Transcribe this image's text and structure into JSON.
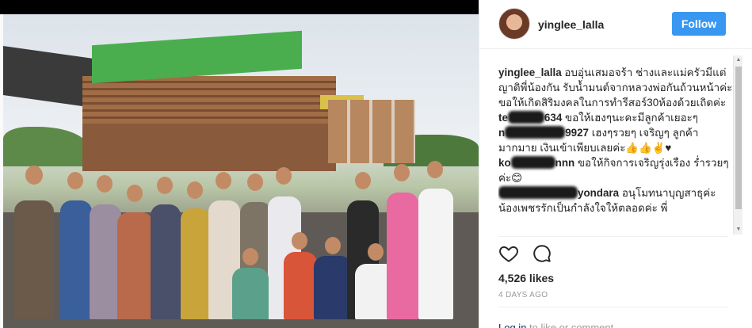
{
  "post": {
    "username": "yinglee_lalla",
    "follow_label": "Follow",
    "likes": "4,526 likes",
    "time": "4 DAYS AGO",
    "login_link": "Log in",
    "login_rest": " to like or comment."
  },
  "comments": [
    {
      "user": "yinglee_lalla",
      "text": " อบอุ่นเสมอจร้า ช่างและแม่ครัวมีแต่ญาติพี่น้องกัน รับน้ำมนต์จากหลวงพ่อกันถ้วนหน้าค่ะ ขอให้เกิดสิริมงคลในการทำรีสอร์30ห้องด้วยเถิดค่ะ"
    },
    {
      "user": "te",
      "suffix": "634",
      "text": " ขอให้เฮงๆนะคะมีลูกค้าเยอะๆ"
    },
    {
      "user": "n",
      "suffix": "9927",
      "text": " เฮงๆรวยๆ เจริญๆ ลูกค้ามากมาย เงินเข้าเพียบเลยค่ะ👍👍✌️♥"
    },
    {
      "user": "ko",
      "suffix": "nnn",
      "text": " ขอให้กิจการเจริญรุ่งเรือง ร่ำรวยๆค่ะ😊"
    },
    {
      "user": "",
      "suffix": "yondara",
      "text": " อนุโมทนาบุญสาธุค่ะ น้องเพชรรักเป็นกำลังใจให้ตลอดค่ะ พี่"
    }
  ],
  "colors": {
    "follow_bg": "#3897f0",
    "link": "#003569",
    "muted": "#999999"
  },
  "icons": [
    "heart-icon",
    "comment-icon",
    "scroll-up-icon",
    "scroll-down-icon"
  ]
}
